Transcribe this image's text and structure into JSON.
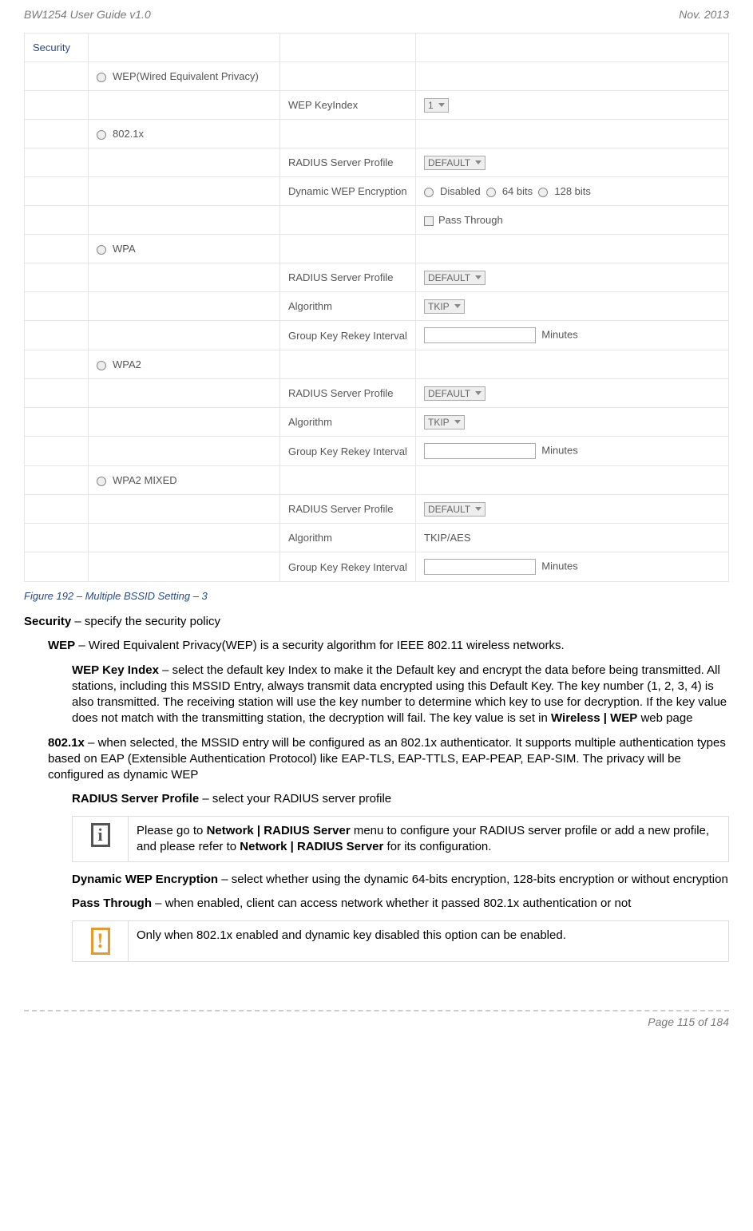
{
  "header": {
    "left": "BW1254 User Guide v1.0",
    "right": "Nov.  2013"
  },
  "table": {
    "security_label": "Security",
    "wep_option": "WEP(Wired Equivalent Privacy)",
    "wep_keyindex_label": "WEP KeyIndex",
    "wep_keyindex_value": "1",
    "x8021_option": "802.1x",
    "radius_profile_label": "RADIUS Server Profile",
    "radius_profile_value": "DEFAULT",
    "dyn_wep_label": "Dynamic WEP Encryption",
    "dyn_wep_disabled": "Disabled",
    "dyn_wep_64": "64 bits",
    "dyn_wep_128": "128 bits",
    "pass_through": "Pass Through",
    "wpa_option": "WPA",
    "algorithm_label": "Algorithm",
    "algorithm_value": "TKIP",
    "group_key_label": "Group Key Rekey Interval",
    "minutes": "Minutes",
    "wpa2_option": "WPA2",
    "wpa2mixed_option": "WPA2 MIXED",
    "tkip_aes": "TKIP/AES"
  },
  "caption": "Figure 192 – Multiple BSSID Setting – 3",
  "body": {
    "security_intro_bold": "Security",
    "security_intro_rest": " – specify the security policy",
    "wep_bold": "WEP",
    "wep_rest": " – Wired Equivalent Privacy(WEP) is a security algorithm for IEEE 802.11 wireless networks.",
    "wep_key_bold": "WEP Key Index",
    "wep_key_rest_1": " – select the default key Index to make it the Default key and encrypt the data before being transmitted. All stations, including this MSSID Entry, always transmit data encrypted using this Default Key. The key number (1, 2, 3, 4) is also transmitted. The receiving station will use the key number to determine which key to use for decryption. If the key value does not match with the transmitting station, the decryption will fail. The key value is set in ",
    "wep_key_bold2": "Wireless | WEP",
    "wep_key_rest_2": " web page",
    "x8021_bold": "802.1x",
    "x8021_rest": " – when selected, the MSSID entry will be configured as an 802.1x authenticator. It supports multiple authentication types based on EAP (Extensible Authentication Protocol) like EAP-TLS, EAP-TTLS, EAP-PEAP, EAP-SIM. The privacy will be configured as dynamic WEP",
    "radius_bold": "RADIUS Server Profile",
    "radius_rest": " – select your RADIUS server profile",
    "note1_a": "Please go to ",
    "note1_b": "Network | RADIUS Server",
    "note1_c": " menu to configure your RADIUS server profile or add a new profile, and please refer to ",
    "note1_d": "Network | RADIUS Server",
    "note1_e": " for its configuration.",
    "dyn_bold": "Dynamic WEP Encryption",
    "dyn_rest": " – select whether using the dynamic 64-bits encryption, 128-bits encryption or without encryption",
    "pass_bold": "Pass Through",
    "pass_rest": " – when enabled, client can access network whether it passed 802.1x authentication or not",
    "note2": "Only when 802.1x enabled and dynamic key disabled this option can be enabled."
  },
  "footer": "Page 115 of 184"
}
